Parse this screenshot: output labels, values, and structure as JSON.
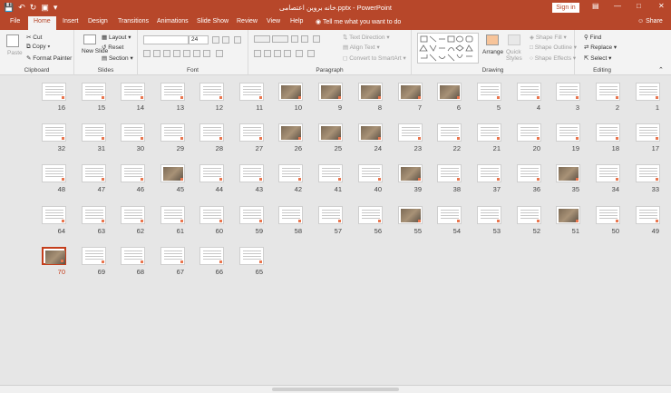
{
  "titlebar": {
    "title": "خانه بروین اعتصامی.pptx  -  PowerPoint",
    "signin": "Sign in",
    "qat": [
      "save-icon",
      "undo-icon",
      "redo-icon",
      "slideshow-icon",
      "customize-icon"
    ],
    "controls": [
      "ribbon-display-icon",
      "minimize-icon",
      "maximize-icon",
      "close-icon"
    ]
  },
  "tabs": [
    "File",
    "Home",
    "Insert",
    "Design",
    "Transitions",
    "Animations",
    "Slide Show",
    "Review",
    "View",
    "Help"
  ],
  "tellme": "Tell me what you want to do",
  "share": "Share",
  "ribbon": {
    "clipboard": {
      "label": "Clipboard",
      "paste": "Paste",
      "cut": "Cut",
      "copy": "Copy",
      "format_painter": "Format Painter"
    },
    "slides": {
      "label": "Slides",
      "new_slide": "New Slide",
      "layout": "Layout",
      "reset": "Reset",
      "section": "Section"
    },
    "font": {
      "label": "Font",
      "name": "",
      "size": "24"
    },
    "paragraph": {
      "label": "Paragraph",
      "text_direction": "Text Direction",
      "align_text": "Align Text",
      "convert": "Convert to SmartArt"
    },
    "drawing": {
      "label": "Drawing",
      "arrange": "Arrange",
      "quick_styles": "Quick Styles",
      "shape_fill": "Shape Fill",
      "shape_outline": "Shape Outline",
      "shape_effects": "Shape Effects"
    },
    "editing": {
      "label": "Editing",
      "find": "Find",
      "replace": "Replace",
      "select": "Select"
    }
  },
  "slides": {
    "selected": 70,
    "photo_slides": [
      10,
      9,
      8,
      7,
      6,
      26,
      25,
      24,
      45,
      39,
      35,
      55,
      51,
      70
    ],
    "rows": [
      [
        16,
        15,
        14,
        13,
        12,
        11,
        10,
        9,
        8,
        7,
        6,
        5,
        4,
        3,
        2,
        1
      ],
      [
        32,
        31,
        30,
        29,
        28,
        27,
        26,
        25,
        24,
        23,
        22,
        21,
        20,
        19,
        18,
        17
      ],
      [
        48,
        47,
        46,
        45,
        44,
        43,
        42,
        41,
        40,
        39,
        38,
        37,
        36,
        35,
        34,
        33
      ],
      [
        64,
        63,
        62,
        61,
        60,
        59,
        58,
        57,
        56,
        55,
        54,
        53,
        52,
        51,
        50,
        49
      ],
      [
        70,
        69,
        68,
        67,
        66,
        65
      ]
    ]
  },
  "colors": {
    "accent": "#b7472a",
    "selected": "#c43e1c"
  }
}
